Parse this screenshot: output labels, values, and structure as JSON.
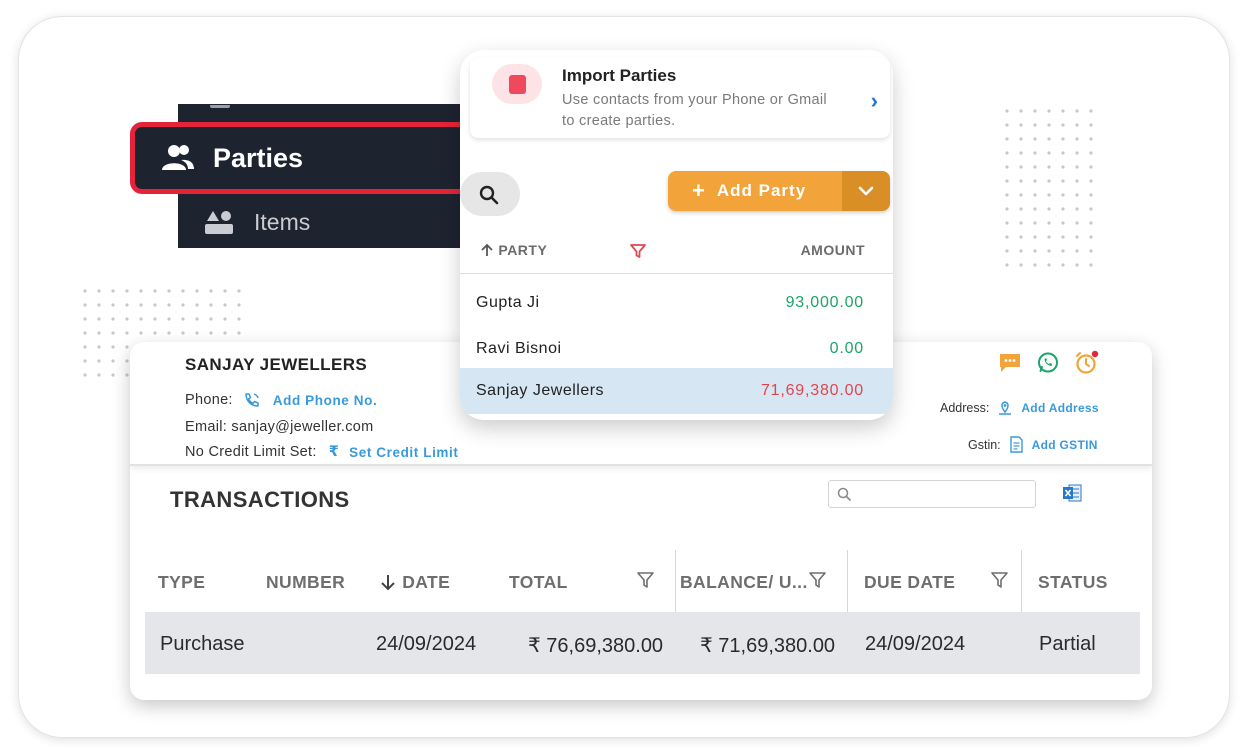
{
  "sidebar": {
    "active_label": "Parties",
    "next_label": "Items"
  },
  "import_parties": {
    "title": "Import Parties",
    "description": "Use contacts from your Phone or Gmail to create parties."
  },
  "add_party": {
    "label": "Add Party"
  },
  "party_list": {
    "col_party": "PARTY",
    "col_amount": "AMOUNT",
    "rows": [
      {
        "name": "Gupta Ji",
        "amount": "93,000.00",
        "color": "#1aa56b"
      },
      {
        "name": "Ravi Bisnoi",
        "amount": "0.00",
        "color": "#1aa56b"
      },
      {
        "name": "Sanjay Jewellers",
        "amount": "71,69,380.00",
        "color": "#e0464f"
      }
    ]
  },
  "party_detail": {
    "name": "SANJAY JEWELLERS",
    "phone_label": "Phone:",
    "phone_link": "Add Phone No.",
    "email": "Email: sanjay@jeweller.com",
    "credit_label": "No Credit Limit Set:",
    "credit_link": "Set Credit Limit",
    "address_label": "Address:",
    "address_link": "Add Address",
    "gstin_label": "Gstin:",
    "gstin_link": "Add GSTIN"
  },
  "transactions": {
    "title": "TRANSACTIONS",
    "columns": [
      "TYPE",
      "NUMBER",
      "DATE",
      "TOTAL",
      "BALANCE/ U...",
      "DUE DATE",
      "STATUS"
    ],
    "rows": [
      {
        "type": "Purchase",
        "number": "",
        "date": "24/09/2024",
        "total": "₹ 76,69,380.00",
        "balance": "₹ 71,69,380.00",
        "due_date": "24/09/2024",
        "status": "Partial"
      }
    ]
  },
  "colors": {
    "accent_orange": "#f2a33a",
    "highlight_red": "#e5243b",
    "link_blue": "#3a9ad9",
    "positive_green": "#1aa56b",
    "negative_red": "#e0464f"
  }
}
